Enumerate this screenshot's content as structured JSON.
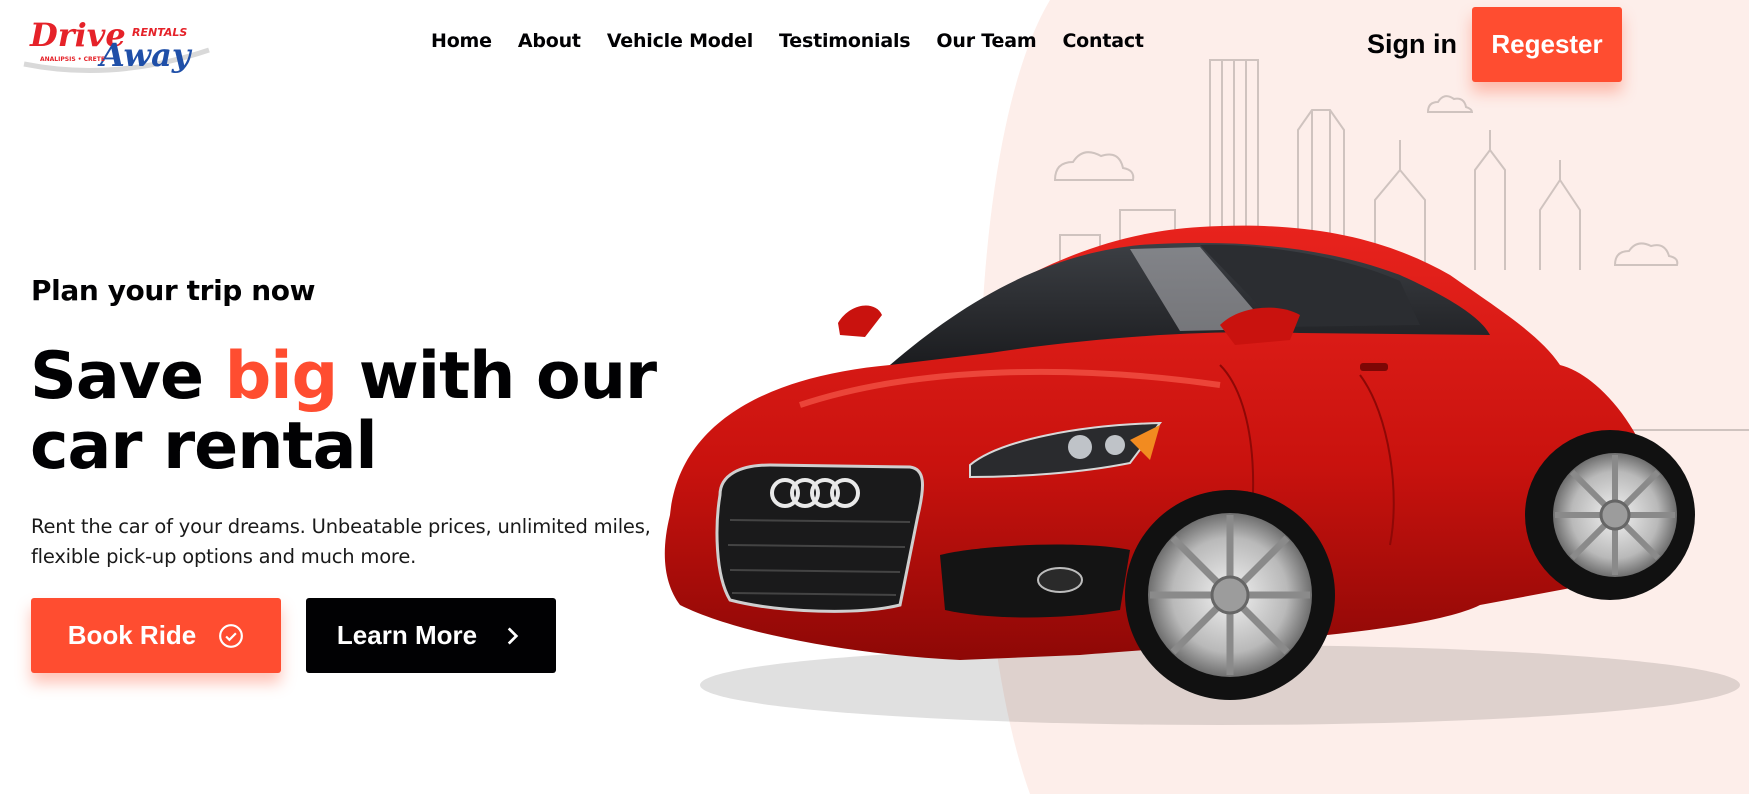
{
  "logo": {
    "word1": "Drive",
    "word2": "Away",
    "tag": "RENTALS",
    "sub": "ANALIPSIS • CRETE"
  },
  "nav": {
    "items": [
      {
        "label": "Home"
      },
      {
        "label": "About"
      },
      {
        "label": "Vehicle Model"
      },
      {
        "label": "Testimonials"
      },
      {
        "label": "Our Team"
      },
      {
        "label": "Contact"
      }
    ]
  },
  "auth": {
    "sign_in": "Sign in",
    "register": "Regester"
  },
  "hero": {
    "kicker": "Plan your trip now",
    "headline_pre": "Save ",
    "headline_accent": "big",
    "headline_post": " with our car rental",
    "lede": "Rent the car of your dreams. Unbeatable prices, unlimited miles, flexible pick-up options and much more.",
    "book_label": "Book Ride",
    "learn_label": "Learn More"
  },
  "colors": {
    "accent": "#ff4d30",
    "dark": "#010103",
    "backdrop": "#fdeeea"
  },
  "icons": {
    "book": "check-circle-icon",
    "learn": "chevron-right-icon"
  }
}
